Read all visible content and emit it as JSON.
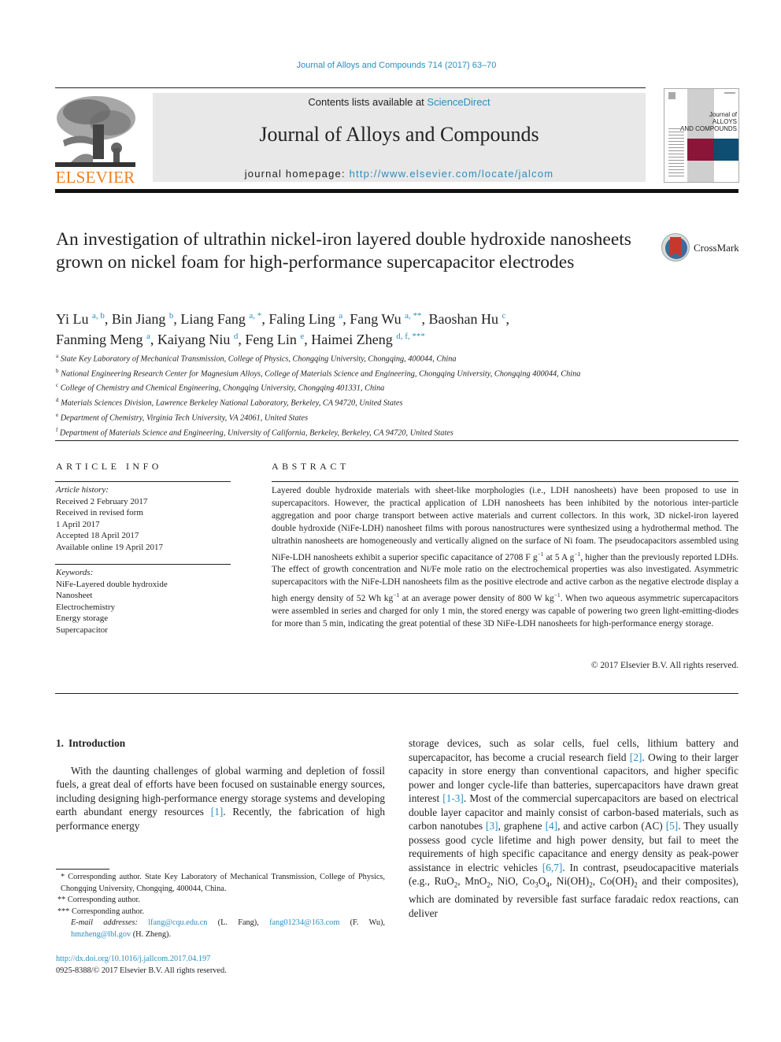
{
  "running_head": "Journal of Alloys and Compounds 714 (2017) 63–70",
  "masthead": {
    "publisher_logo_text": "ELSEVIER",
    "contents_prefix": "Contents lists available at ",
    "contents_link": "ScienceDirect",
    "journal_name": "Journal of Alloys and Compounds",
    "homepage_prefix": "journal homepage: ",
    "homepage_link": "http://www.elsevier.com/locate/jalcom",
    "cover_title_line1": "Journal of",
    "cover_title_line2": "ALLOYS",
    "cover_title_line3": "AND COMPOUNDS",
    "colors": {
      "elsevier_orange": "#f07d1a",
      "link_blue": "#2a8dbf",
      "cover_red": "#8b1538",
      "cover_blue": "#0e4e73"
    }
  },
  "article": {
    "title": "An investigation of ultrathin nickel-iron layered double hydroxide nanosheets grown on nickel foam for high-performance supercapacitor electrodes",
    "crossmark_label": "CrossMark",
    "authors": [
      {
        "name": "Yi Lu",
        "sup": "a, b"
      },
      {
        "name": "Bin Jiang",
        "sup": "b"
      },
      {
        "name": "Liang Fang",
        "sup": "a, *"
      },
      {
        "name": "Faling Ling",
        "sup": "a"
      },
      {
        "name": "Fang Wu",
        "sup": "a, **"
      },
      {
        "name": "Baoshan Hu",
        "sup": "c"
      },
      {
        "name": "Fanming Meng",
        "sup": "a"
      },
      {
        "name": "Kaiyang Niu",
        "sup": "d"
      },
      {
        "name": "Feng Lin",
        "sup": "e"
      },
      {
        "name": "Haimei Zheng",
        "sup": "d, f, ***"
      }
    ],
    "affiliations": [
      {
        "key": "a",
        "text": "State Key Laboratory of Mechanical Transmission, College of Physics, Chongqing University, Chongqing, 400044, China"
      },
      {
        "key": "b",
        "text": "National Engineering Research Center for Magnesium Alloys, College of Materials Science and Engineering, Chongqing University, Chongqing 400044, China"
      },
      {
        "key": "c",
        "text": "College of Chemistry and Chemical Engineering, Chongqing University, Chongqing 401331, China"
      },
      {
        "key": "d",
        "text": "Materials Sciences Division, Lawrence Berkeley National Laboratory, Berkeley, CA 94720, United States"
      },
      {
        "key": "e",
        "text": "Department of Chemistry, Virginia Tech University, VA 24061, United States"
      },
      {
        "key": "f",
        "text": "Department of Materials Science and Engineering, University of California, Berkeley, Berkeley, CA 94720, United States"
      }
    ]
  },
  "article_info": {
    "heading": "ARTICLE INFO",
    "history_label": "Article history:",
    "history": [
      "Received 2 February 2017",
      "Received in revised form",
      "1 April 2017",
      "Accepted 18 April 2017",
      "Available online 19 April 2017"
    ],
    "keywords_label": "Keywords:",
    "keywords": [
      "NiFe-Layered double hydroxide",
      "Nanosheet",
      "Electrochemistry",
      "Energy storage",
      "Supercapacitor"
    ]
  },
  "abstract": {
    "heading": "ABSTRACT",
    "part1": "Layered double hydroxide materials with sheet-like morphologies (i.e., LDH nanosheets) have been proposed to use in supercapacitors. However, the practical application of LDH nanosheets has been inhibited by the notorious inter-particle aggregation and poor charge transport between active materials and current collectors. In this work, 3D nickel-iron layered double hydroxide (NiFe-LDH) nanosheet films with porous nanostructures were synthesized using a hydrothermal method. The ultrathin nanosheets are homogeneously and vertically aligned on the surface of Ni foam. The pseudocapacitors assembled using NiFe-LDH nanosheets exhibit a superior specific capacitance of 2708 F g",
    "sup1": "−1",
    "part2": " at 5 A g",
    "sup2": "−1",
    "part3": ", higher than the previously reported LDHs. The effect of growth concentration and Ni/Fe mole ratio on the electrochemical properties was also investigated. Asymmetric supercapacitors with the NiFe-LDH nanosheets film as the positive electrode and active carbon as the negative electrode display a high energy density of 52 Wh kg",
    "sup3": "−1",
    "part4": " at an average power density of 800 W kg",
    "sup4": "−1",
    "part5": ". When two aqueous asymmetric supercapacitors were assembled in series and charged for only 1 min, the stored energy was capable of powering two green light-emitting-diodes for more than 5 min, indicating the great potential of these 3D NiFe-LDH nanosheets for high-performance energy storage.",
    "copyright": "© 2017 Elsevier B.V. All rights reserved."
  },
  "introduction": {
    "number": "1.",
    "heading": "Introduction",
    "left_p1": "With the daunting challenges of global warming and depletion of fossil fuels, a great deal of efforts have been focused on sustainable energy sources, including designing high-performance energy storage systems and developing earth abundant energy resources ",
    "left_ref1": "[1]",
    "left_p2": ". Recently, the fabrication of high performance energy",
    "right": {
      "t1": "storage devices, such as solar cells, fuel cells, lithium battery and supercapacitor, has become a crucial research field ",
      "r1": "[2]",
      "t2": ". Owing to their larger capacity in store energy than conventional capacitors, and higher specific power and longer cycle-life than batteries, supercapacitors have drawn great interest ",
      "r2": "[1-3]",
      "t3": ". Most of the commercial supercapacitors are based on electrical double layer capacitor and mainly consist of carbon-based materials, such as carbon nanotubes ",
      "r3": "[3]",
      "t4": ", graphene ",
      "r4": "[4]",
      "t5": ", and active carbon (AC) ",
      "r5": "[5]",
      "t6": ". They usually possess good cycle lifetime and high power density, but fail to meet the requirements of high specific capacitance and energy density as peak-power assistance in electric vehicles ",
      "r6": "[6,7]",
      "t7": ". In contrast, pseudocapacitive materials (e.g., RuO",
      "t8": ", MnO",
      "t9": ", NiO, Co",
      "t10": "O",
      "t11": ", Ni(OH)",
      "t12": ", Co(OH)",
      "t13": " and their composites), which are dominated by reversible fast surface faradaic redox reactions, can deliver",
      "sub2": "2",
      "sub3": "3",
      "sub4": "4"
    }
  },
  "footnotes": {
    "fn1": "* Corresponding author. State Key Laboratory of Mechanical Transmission, College of Physics, Chongqing University, Chongqing, 400044, China.",
    "fn2": "** Corresponding author.",
    "fn3": "*** Corresponding author.",
    "email_label": "E-mail addresses:",
    "email1": "lfang@cqu.edu.cn",
    "email1_who": " (L. Fang), ",
    "email2": "fang01234@163.com",
    "email2_who": " (F. Wu), ",
    "email3": "hmzheng@lbl.gov",
    "email3_who": " (H. Zheng).",
    "doi": "http://dx.doi.org/10.1016/j.jallcom.2017.04.197",
    "issn_copyright": "0925-8388/© 2017 Elsevier B.V. All rights reserved."
  }
}
